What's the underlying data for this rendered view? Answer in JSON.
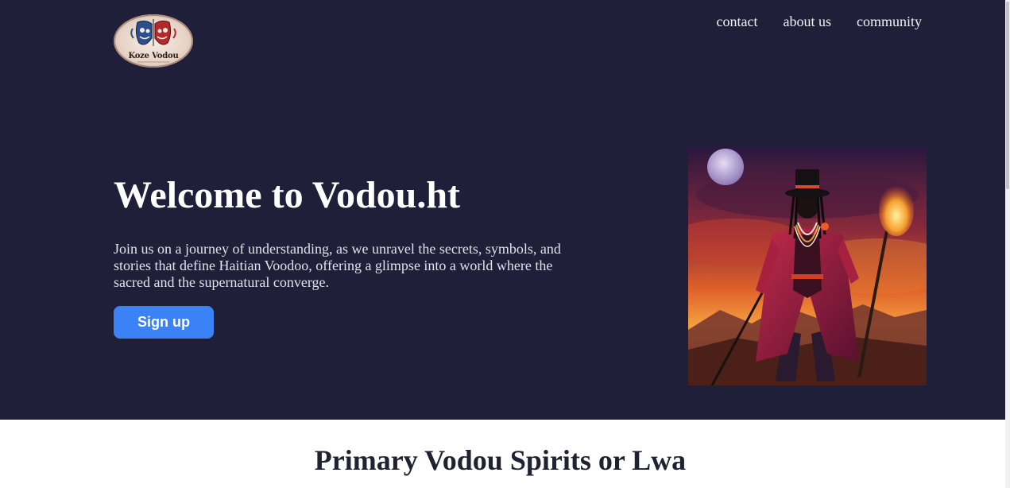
{
  "header": {
    "logo": {
      "text": "Koze Vodou"
    },
    "nav": [
      {
        "label": "contact"
      },
      {
        "label": "about us"
      },
      {
        "label": "community"
      }
    ]
  },
  "hero": {
    "title": "Welcome to Vodou.ht",
    "description": "Join us on a journey of understanding, as we unravel the secrets, symbols, and stories that define Haitian Voodoo, offering a glimpse into a world where the sacred and the supernatural converge.",
    "signup_label": "Sign up",
    "image_icon": "vodou-figure-illustration"
  },
  "section": {
    "title": "Primary Vodou Spirits or Lwa"
  },
  "colors": {
    "hero_bg": "#1f1f3a",
    "accent": "#3b82f6",
    "text_light": "#ffffff",
    "text_dark": "#1f2230"
  }
}
